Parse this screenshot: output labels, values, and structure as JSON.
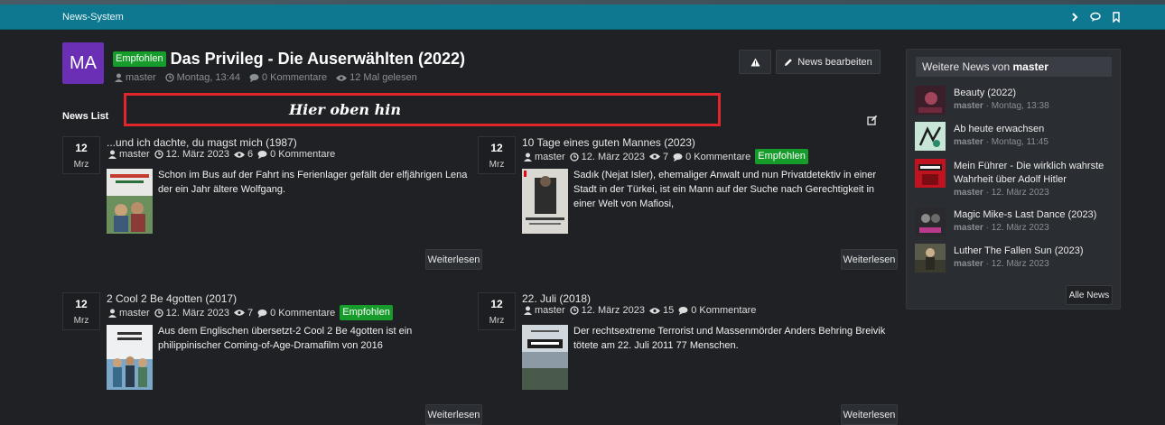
{
  "nav": {
    "brand": "News-System",
    "icons": [
      "chevron-right-icon",
      "comments-icon",
      "bookmark-icon"
    ]
  },
  "colors": {
    "navbar": "#0e7891",
    "accent_green": "#169c2a",
    "avatar": "#6a2fb4",
    "annotation_red": "#e0262a"
  },
  "article": {
    "avatar_initials": "MA",
    "badge": "Empfohlen",
    "title": "Das Privileg - Die Auserwählten (2022)",
    "author": "master",
    "date": "Montag, 13:44",
    "comments": "0 Kommentare",
    "views": "12 Mal gelesen"
  },
  "toolbar": {
    "report_icon": "warning-icon",
    "edit_label": "News bearbeiten"
  },
  "newslist": {
    "label": "News List",
    "annotation": "Hier oben hin",
    "read_more": "Weiterlesen",
    "items": [
      {
        "day": "12",
        "month": "Mrz",
        "title": "...und ich dachte, du magst mich (1987)",
        "author": "master",
        "date": "12. März 2023",
        "views": "6",
        "comments": "0 Kommentare",
        "badge": "",
        "description": "Schon im Bus auf der Fahrt ins Ferienlager gefällt der elfjährigen Lena der ein Jahr ältere Wolfgang."
      },
      {
        "day": "12",
        "month": "Mrz",
        "title": "10 Tage eines guten Mannes (2023)",
        "author": "master",
        "date": "12. März 2023",
        "views": "7",
        "comments": "0 Kommentare",
        "badge": "Empfohlen",
        "description": "Sadık (Nejat Isler), ehemaliger Anwalt und nun Privatdetektiv in einer Stadt in der Türkei, ist ein Mann auf der Suche nach Gerechtigkeit in einer Welt von Mafiosi,"
      },
      {
        "day": "12",
        "month": "Mrz",
        "title": "2 Cool 2 Be 4gotten (2017)",
        "author": "master",
        "date": "12. März 2023",
        "views": "7",
        "comments": "0 Kommentare",
        "badge": "Empfohlen",
        "description": "Aus dem Englischen übersetzt-2 Cool 2 Be 4gotten ist ein philippinischer Coming-of-Age-Dramafilm von 2016"
      },
      {
        "day": "12",
        "month": "Mrz",
        "title": "22. Juli (2018)",
        "author": "master",
        "date": "12. März 2023",
        "views": "15",
        "comments": "0 Kommentare",
        "badge": "",
        "description": "Der rechtsextreme Terrorist und Massenmörder Anders Behring Breivik tötete am 22. Juli 2011 77 Menschen."
      }
    ]
  },
  "sidebar": {
    "heading_prefix": "Weitere News von",
    "heading_user": "master",
    "all_news": "Alle News",
    "items": [
      {
        "title": "Beauty (2022)",
        "author": "master",
        "date": "Montag, 13:38"
      },
      {
        "title": "Ab heute erwachsen",
        "author": "master",
        "date": "Montag, 11:45"
      },
      {
        "title": "Mein Führer - Die wirklich wahrste Wahrheit über Adolf Hitler",
        "author": "master",
        "date": "12. März 2023"
      },
      {
        "title": "Magic Mike-s Last Dance (2023)",
        "author": "master",
        "date": "12. März 2023"
      },
      {
        "title": "Luther The Fallen Sun (2023)",
        "author": "master",
        "date": "12. März 2023"
      }
    ]
  }
}
